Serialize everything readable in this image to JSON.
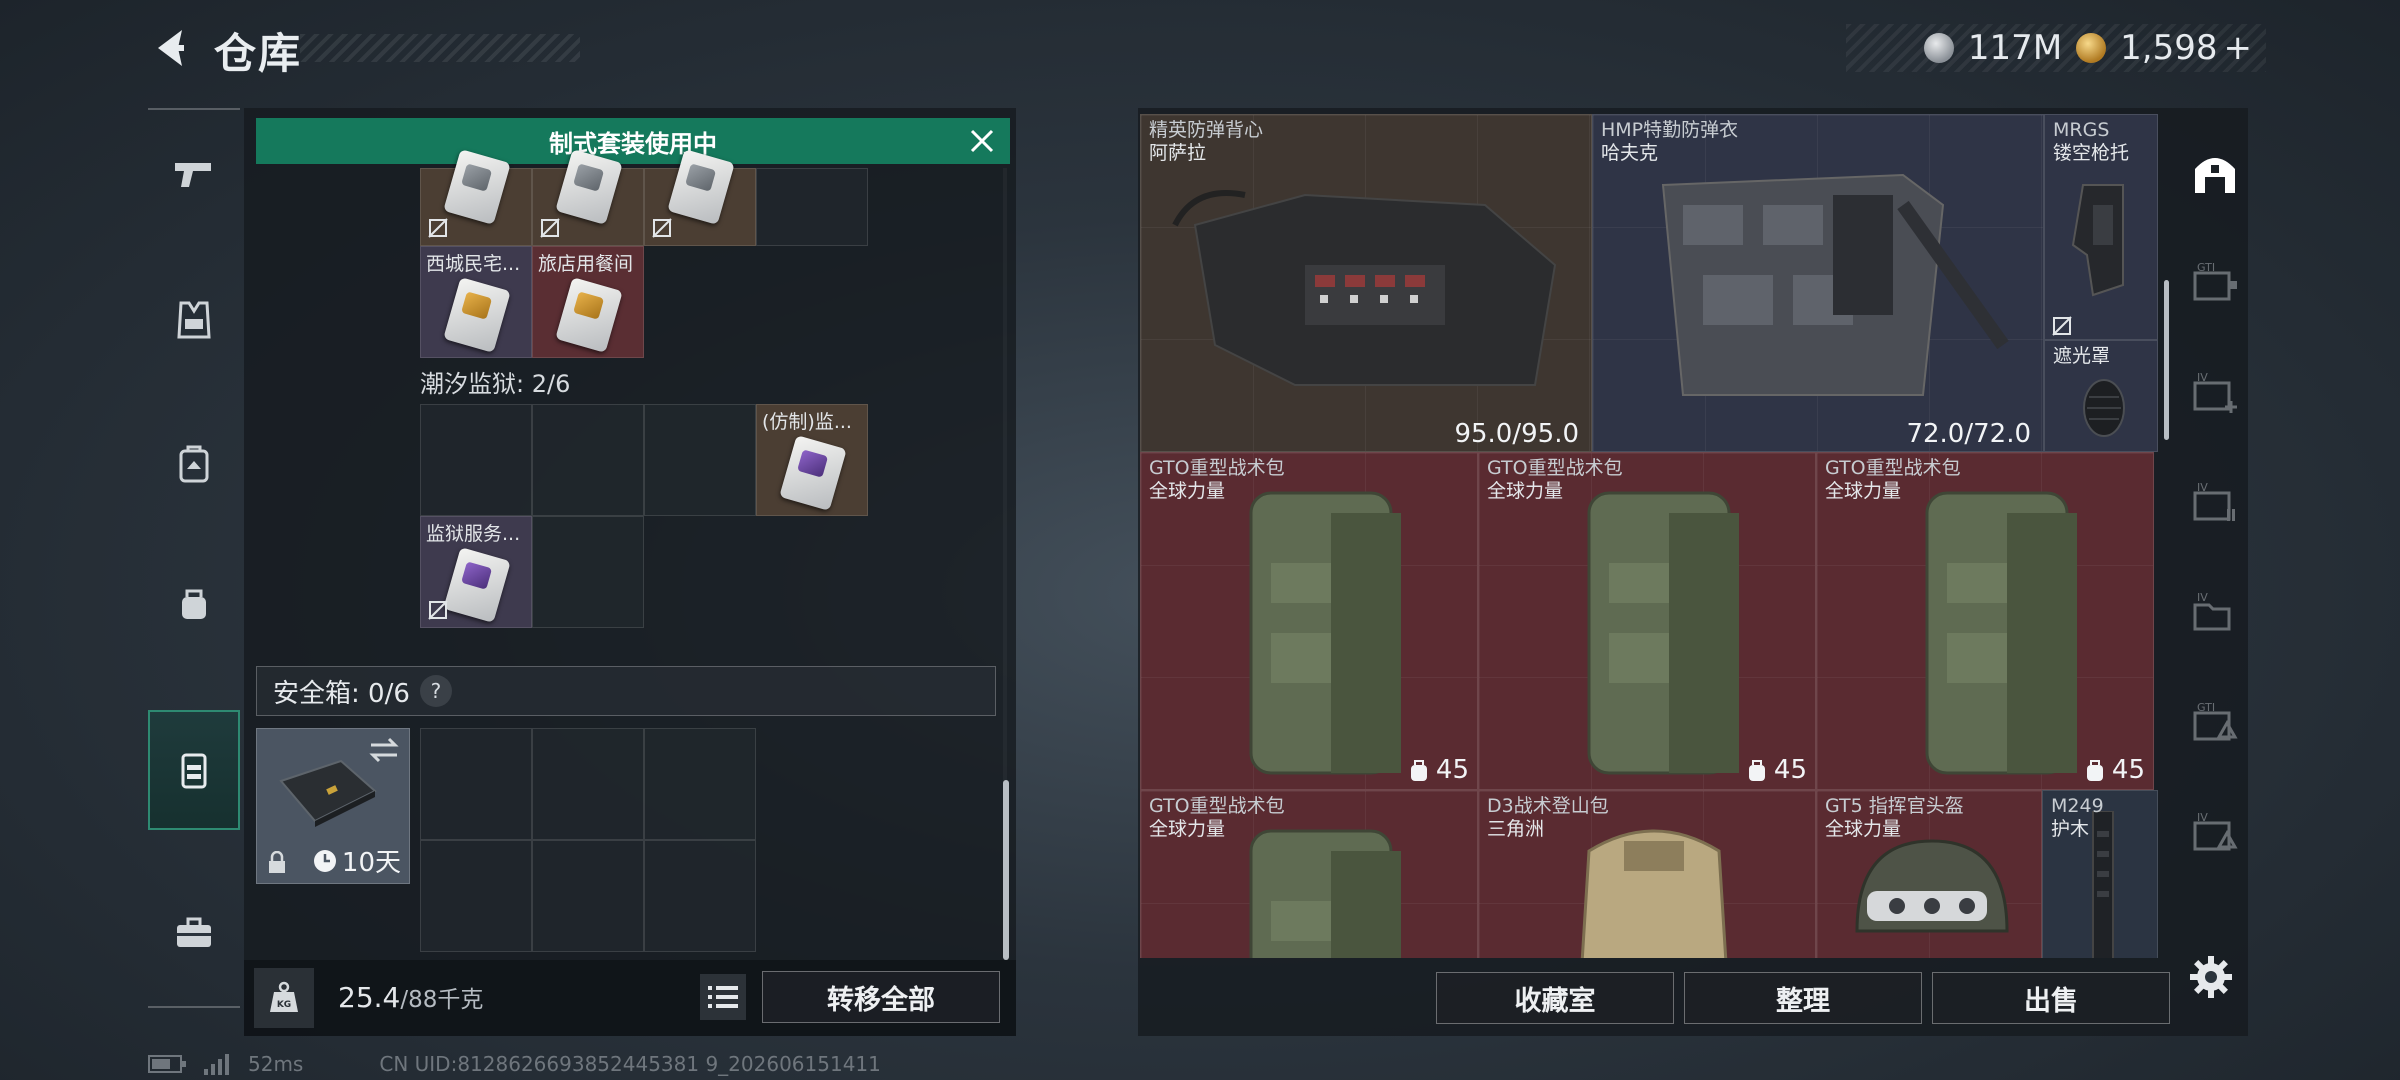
{
  "header": {
    "title": "仓库",
    "currencies": [
      {
        "icon": "silver-coin-icon",
        "value": "117M"
      },
      {
        "icon": "gold-coin-icon",
        "value": "1,598"
      }
    ],
    "currency_add": "+"
  },
  "left_nav": [
    "pistol-icon",
    "vest-icon",
    "backpack-icon",
    "pouch-icon",
    "case-icon",
    "toolbox-icon"
  ],
  "left_panel": {
    "banner": "制式套装使用中",
    "top_items": [
      {
        "label": "西城民宅...",
        "color": "tan"
      },
      {
        "label": "旅店用餐间",
        "color": "red"
      }
    ],
    "section_prison": "潮汐监狱: 2/6",
    "prison_items": [
      {
        "label": "(仿制)监..."
      },
      {
        "label": "监狱服务..."
      }
    ],
    "safebox": {
      "title": "安全箱: 0/6",
      "help": "?",
      "days": "10天"
    },
    "weight": {
      "current": "25.4",
      "max": "/88千克"
    },
    "transfer_all": "转移全部"
  },
  "right_panel": {
    "tiles": [
      {
        "name": "精英防弹背心",
        "sub": "阿萨拉",
        "durability": "95.0/95.0"
      },
      {
        "name": "HMP特勤防弹衣",
        "sub": "哈夫克",
        "durability": "72.0/72.0"
      },
      {
        "name": "MRGS",
        "sub": "镂空枪托"
      },
      {
        "name": "遮光罩",
        "sub": ""
      },
      {
        "name": "GTO重型战术包",
        "sub": "全球力量",
        "capacity": "45"
      },
      {
        "name": "GTO重型战术包",
        "sub": "全球力量",
        "capacity": "45"
      },
      {
        "name": "GTO重型战术包",
        "sub": "全球力量",
        "capacity": "45"
      },
      {
        "name": "GTO重型战术包",
        "sub": "全球力量"
      },
      {
        "name": "D3战术登山包",
        "sub": "三角洲"
      },
      {
        "name": "GT5 指挥官头盔",
        "sub": "全球力量"
      },
      {
        "name": "M249",
        "sub": "护木"
      }
    ],
    "buttons": {
      "collection": "收藏室",
      "organize": "整理",
      "sell": "出售"
    }
  },
  "status_bar": {
    "ping": "52ms",
    "uid": "CN UID:8128626693852445381 9_202606151411"
  },
  "colors": {
    "accent_green": "#15795c",
    "tile_red": "#5a2b31",
    "tile_brown": "#3e3630"
  }
}
